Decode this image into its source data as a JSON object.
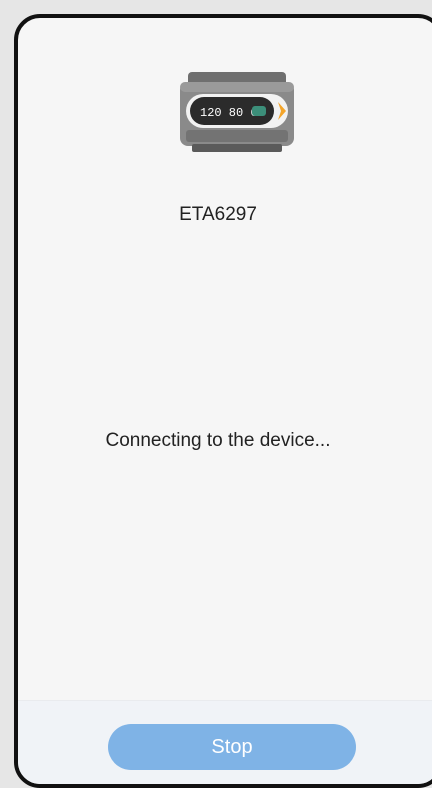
{
  "device": {
    "name": "ETA6297",
    "display_text": "120 80 68",
    "image_icon": "blood-pressure-monitor-icon"
  },
  "status": {
    "message": "Connecting to the device..."
  },
  "actions": {
    "stop_label": "Stop"
  },
  "colors": {
    "background": "#f6f6f6",
    "frame": "#111111",
    "button": "#7fb3e6",
    "button_text": "#ffffff",
    "bottom_bar": "#f0f3f7",
    "accent_orange": "#f4a52a"
  }
}
